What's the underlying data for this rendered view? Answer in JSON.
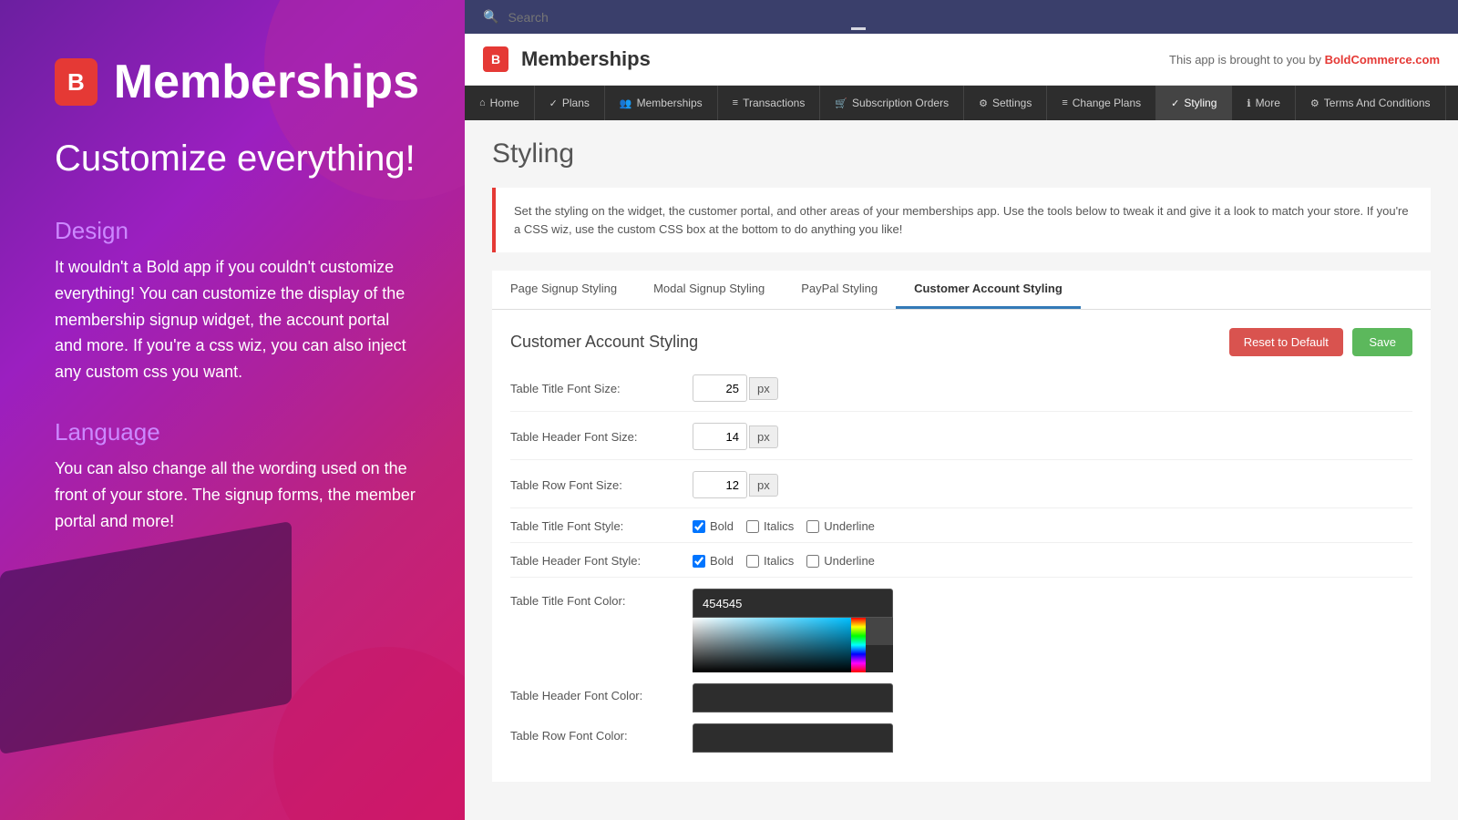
{
  "left": {
    "logo_icon": "B",
    "logo_text": "Memberships",
    "tagline": "Customize everything!",
    "section1_title": "Design",
    "section1_text": "It wouldn't a Bold app if you couldn't customize everything! You can customize the display of the membership signup widget, the account portal and more. If you're a css wiz, you can also inject any custom css you want.",
    "section2_title": "Language",
    "section2_text": "You can also change all the wording used on the front of your store. The signup forms, the member portal and more!"
  },
  "right": {
    "search_placeholder": "Search",
    "app_header_title": "Memberships",
    "app_header_brought": "This app is brought to you by ",
    "app_header_brand": "BoldCommerce.com",
    "nav": [
      {
        "label": "Home",
        "icon": "⌂"
      },
      {
        "label": "Plans",
        "icon": "✓"
      },
      {
        "label": "Memberships",
        "icon": "👥"
      },
      {
        "label": "Transactions",
        "icon": "≡"
      },
      {
        "label": "Subscription Orders",
        "icon": "🛒"
      },
      {
        "label": "Settings",
        "icon": "⚙"
      },
      {
        "label": "Change Plans",
        "icon": "≡"
      },
      {
        "label": "Styling",
        "icon": "✓",
        "active": true
      },
      {
        "label": "More",
        "icon": "ℹ"
      },
      {
        "label": "Terms And Conditions",
        "icon": "⚙"
      }
    ],
    "page_title": "Styling",
    "info_text": "Set the styling on the widget, the customer portal, and other areas of your memberships app. Use the tools below to tweak it and give it a look to match your store. If you're a CSS wiz, use the custom CSS box at the bottom to do anything you like!",
    "tabs": [
      {
        "label": "Page Signup Styling"
      },
      {
        "label": "Modal Signup Styling"
      },
      {
        "label": "PayPal Styling"
      },
      {
        "label": "Customer Account Styling",
        "active": true
      }
    ],
    "section_title": "Customer Account Styling",
    "btn_reset": "Reset to Default",
    "btn_save": "Save",
    "form_rows": [
      {
        "label": "Table Title Font Size:",
        "value": "25",
        "unit": "px"
      },
      {
        "label": "Table Header Font Size:",
        "value": "14",
        "unit": "px"
      },
      {
        "label": "Table Row Font Size:",
        "value": "12",
        "unit": "px"
      }
    ],
    "style_rows": [
      {
        "label": "Table Title Font Style:",
        "bold": true,
        "italics": false,
        "underline": false
      },
      {
        "label": "Table Header Font Style:",
        "bold": true,
        "italics": false,
        "underline": false
      }
    ],
    "color_rows": [
      {
        "label": "Table Title Font Color:",
        "value": "454545"
      },
      {
        "label": "Table Header Font Color:",
        "value": ""
      },
      {
        "label": "Table Row Font Color:",
        "value": ""
      }
    ],
    "checkbox_labels": {
      "bold": "Bold",
      "italics": "Italics",
      "underline": "Underline"
    }
  }
}
